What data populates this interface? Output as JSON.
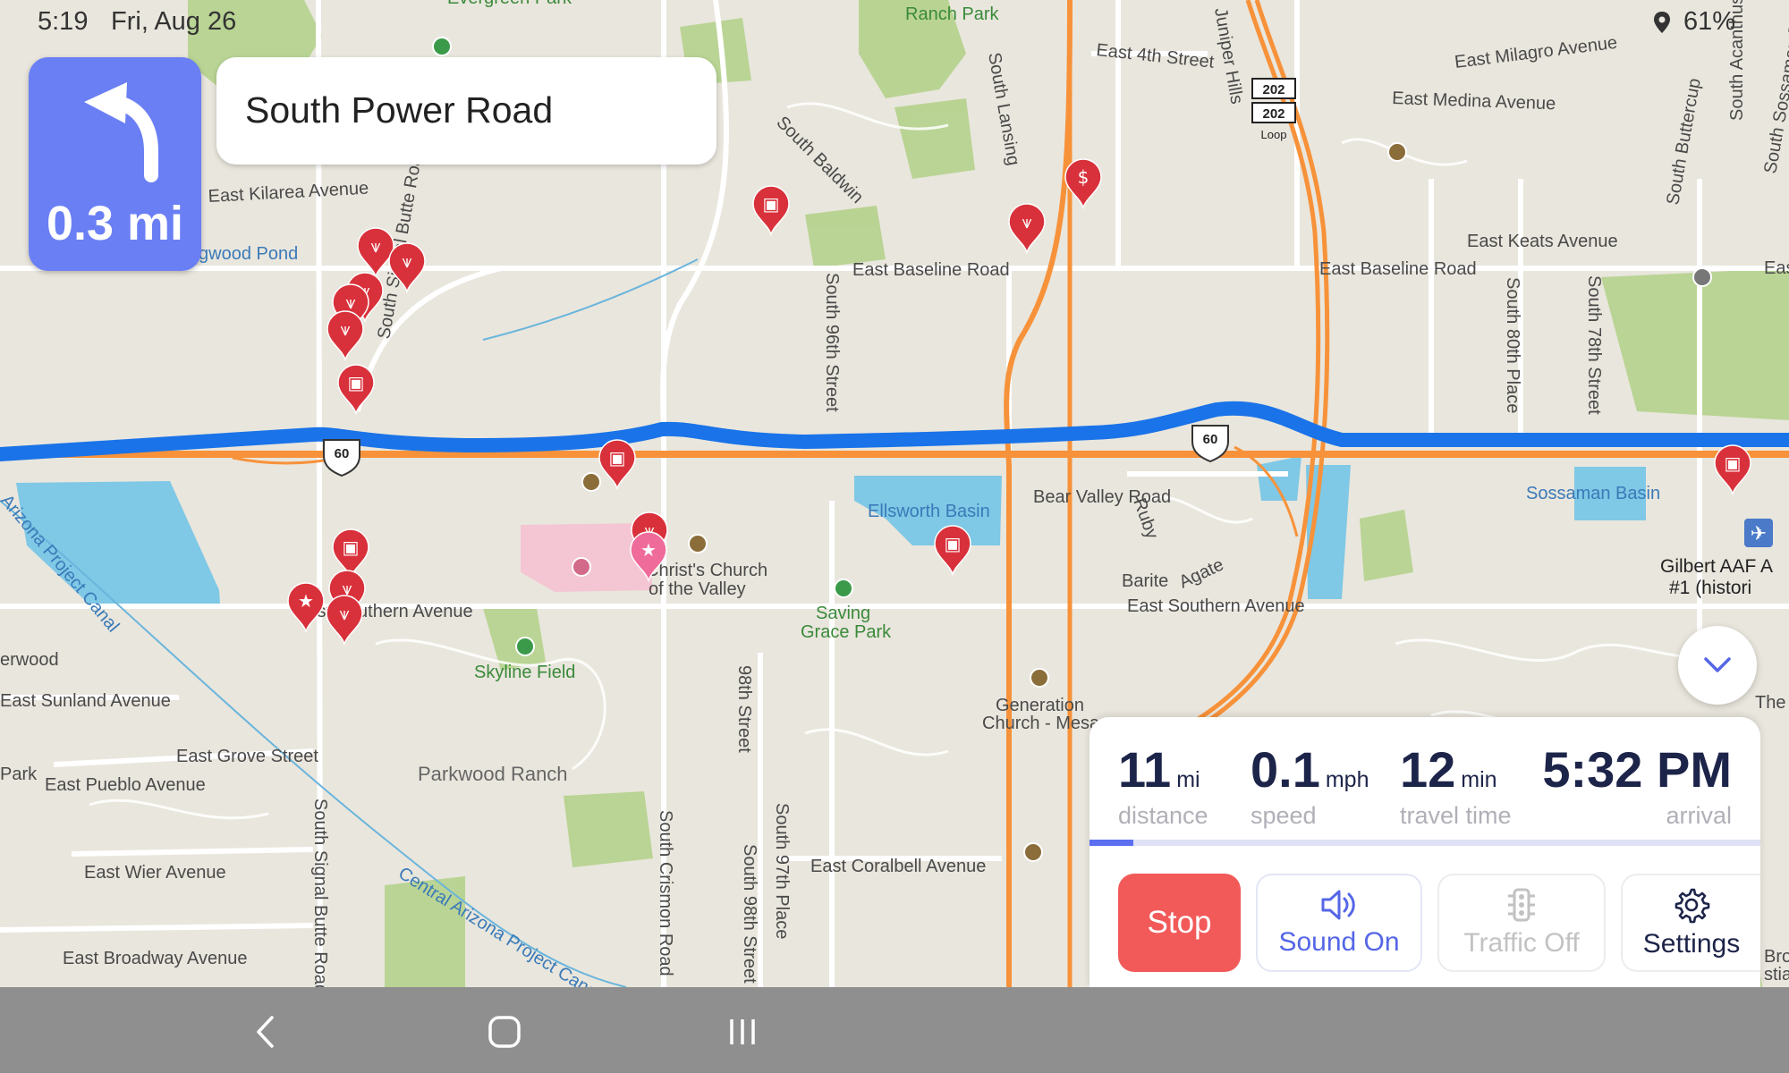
{
  "status_bar": {
    "time": "5:19",
    "date": "Fri, Aug 26",
    "battery": "61%"
  },
  "navigation": {
    "turn_direction": "turn-left-icon",
    "turn_distance": "0.3 mi",
    "next_street": "South Power Road"
  },
  "trip": {
    "distance_value": "11",
    "distance_unit": "mi",
    "distance_label": "distance",
    "speed_value": "0.1",
    "speed_unit": "mph",
    "speed_label": "speed",
    "travel_value": "12",
    "travel_unit": "min",
    "travel_label": "travel time",
    "arrival_value": "5:32 PM",
    "arrival_label": "arrival",
    "route_progress": 0.065
  },
  "controls": {
    "stop": "Stop",
    "sound": "Sound On",
    "traffic": "Traffic Off",
    "settings": "Settings"
  },
  "map": {
    "labels": {
      "evergreen_park": "Evergreen Park",
      "ranch_park": "Ranch Park",
      "e4th": "East 4th Street",
      "juniper_hills": "Juniper Hills",
      "milagro": "East Milagro Avenue",
      "medina": "East Medina Avenue",
      "buttercup": "South Buttercup",
      "acanthus": "South Acanthus",
      "sossaman_road": "South Sossaman Road",
      "kilarea": "East Kilarea Avenue",
      "wood_pond": "gwood Pond",
      "signal_butte_top": "South Signal Butte Roa",
      "baldwin": "South Baldwin",
      "lansing": "South Lansing",
      "baseline_left": "East Baseline Road",
      "baseline_right": "East Baseline Road",
      "baseline_edge": "Eas",
      "keats": "East Keats Avenue",
      "s96th": "South 96th Street",
      "s80th": "South 80th Place",
      "s78th": "South 78th Street",
      "bear_valley": "Bear Valley Road",
      "ruby": "Ruby",
      "barite": "Barite",
      "agate": "Agate",
      "ellsworth": "Ellsworth Basin",
      "sossaman_basin": "Sossaman Basin",
      "church1": "Christ's Church",
      "church2": "of the Valley",
      "saving1": "Saving",
      "saving2": "Grace Park",
      "southern_left": "East Southern Avenue",
      "southern_right": "East Southern Avenue",
      "gilbert1": "Gilbert AAF A",
      "gilbert2": "#1 (histori",
      "erwood": "erwood",
      "sunland": "East Sunland Avenue",
      "skyline": "Skyline Field",
      "generation1": "Generation",
      "generation2": "Church - Mesa",
      "the_c": "The C",
      "grove": "East Grove Street",
      "park": "Park",
      "pueblo": "East Pueblo Avenue",
      "parkwood": "Parkwood Ranch",
      "s98th": "98th Street",
      "wier": "East Wier Avenue",
      "signal_butte_bottom": "South Signal Butte Road",
      "crismon": "South Crismon Road",
      "s97th": "South 97th Place",
      "s98th_b": "South 98th Street",
      "coralbell": "East Coralbell Avenue",
      "canal": "Central Arizona Project Canal",
      "canal_left": "Arizona Project Canal",
      "broadway": "East Broadway Avenue",
      "broa": "Broa",
      "stia": "stia",
      "hwy60": "60",
      "hwy202a": "202",
      "hwy202b": "202",
      "loop": "Loop"
    }
  },
  "colors": {
    "route": "#1a73e8",
    "accent": "#6a7ff4",
    "stop": "#f25a5a",
    "pin": "#d9313b",
    "highway": "#f7923a"
  },
  "icons": [
    "turn-left-icon",
    "chevron-down-icon",
    "speaker-icon",
    "traffic-light-icon",
    "gear-icon",
    "back-icon",
    "home-icon",
    "recents-icon",
    "location-icon"
  ]
}
